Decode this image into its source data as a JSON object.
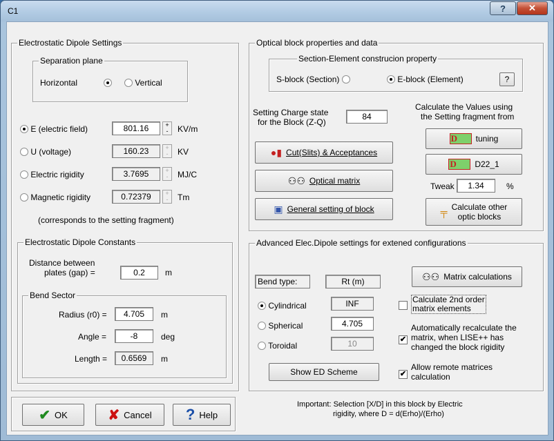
{
  "window": {
    "title": "C1",
    "help_glyph": "?",
    "close_glyph": "✕"
  },
  "left": {
    "group_title": "Electrostatic Dipole Settings",
    "separation": {
      "title": "Separation plane",
      "horizontal": "Horizontal",
      "vertical": "Vertical",
      "selected": "Horizontal"
    },
    "params": [
      {
        "label": "E (electric field)",
        "value": "801.16",
        "unit": "KV/m",
        "selected": true,
        "editable": true
      },
      {
        "label": "U (voltage)",
        "value": "160.23",
        "unit": "KV",
        "selected": false,
        "editable": false
      },
      {
        "label": "Electric rigidity",
        "value": "3.7695",
        "unit": "MJ/C",
        "selected": false,
        "editable": false
      },
      {
        "label": "Magnetic rigidity",
        "value": "0.72379",
        "unit": "Tm",
        "selected": false,
        "editable": false
      }
    ],
    "note": "(corresponds to the setting fragment)",
    "constants": {
      "title": "Electrostatic Dipole Constants",
      "distance_label_1": "Distance between",
      "distance_label_2": "plates (gap) =",
      "distance_value": "0.2",
      "distance_unit": "m",
      "bend": {
        "title": "Bend Sector",
        "radius_label": "Radius (r0) =",
        "radius_value": "4.705",
        "radius_unit": "m",
        "angle_label": "Angle =",
        "angle_value": "-8",
        "angle_unit": "deg",
        "length_label": "Length =",
        "length_value": "0.6569",
        "length_unit": "m"
      }
    }
  },
  "optical": {
    "group_title": "Optical block properties and data",
    "section": {
      "title": "Section-Element construcion property",
      "sblock": "S-block (Section)",
      "eblock": "E-block (Element)",
      "selected": "E-block",
      "help": "?"
    },
    "charge_label_1": "Setting Charge state",
    "charge_label_2": "for the Block (Z-Q)",
    "charge_value": "84",
    "calc_label_1": "Calculate the Values using",
    "calc_label_2": "the Setting fragment from",
    "cut_button": "Cut(Slits) & Acceptances",
    "matrix_button": "Optical matrix",
    "general_button": "General setting of block",
    "tuning_button": "tuning",
    "d22_button": "D22_1",
    "tweak_label": "Tweak",
    "tweak_value": "1.34",
    "tweak_unit": "%",
    "calc_other_1": "Calculate other",
    "calc_other_2": "optic blocks",
    "logo_letter": "D"
  },
  "advanced": {
    "group_title": "Advanced Elec.Dipole settings for extened configurations",
    "bend_type_label": "Bend type:",
    "rt_label": "Rt (m)",
    "types": [
      {
        "label": "Cylindrical",
        "value": "INF",
        "selected": true
      },
      {
        "label": "Spherical",
        "value": "4.705",
        "selected": false
      },
      {
        "label": "Toroidal",
        "value": "10",
        "selected": false
      }
    ],
    "matrix_calc_button": "Matrix calculations",
    "second_order_1": "Calculate 2nd order",
    "second_order_2": "matrix elements",
    "second_order_checked": false,
    "auto_1": "Automatically recalculate the",
    "auto_2": "matrix, when LISE++ has",
    "auto_3": "changed the block rigidity",
    "auto_checked": true,
    "remote_1": "Allow remote matrices",
    "remote_2": "calculation",
    "remote_checked": true,
    "show_scheme_button": "Show ED Scheme"
  },
  "footer": {
    "ok": "OK",
    "cancel": "Cancel",
    "help": "Help",
    "important_1": "Important:  Selection  [X/D] in this block by Electric",
    "important_2": "rigidity, where D = d(Erho)/(Erho)"
  }
}
